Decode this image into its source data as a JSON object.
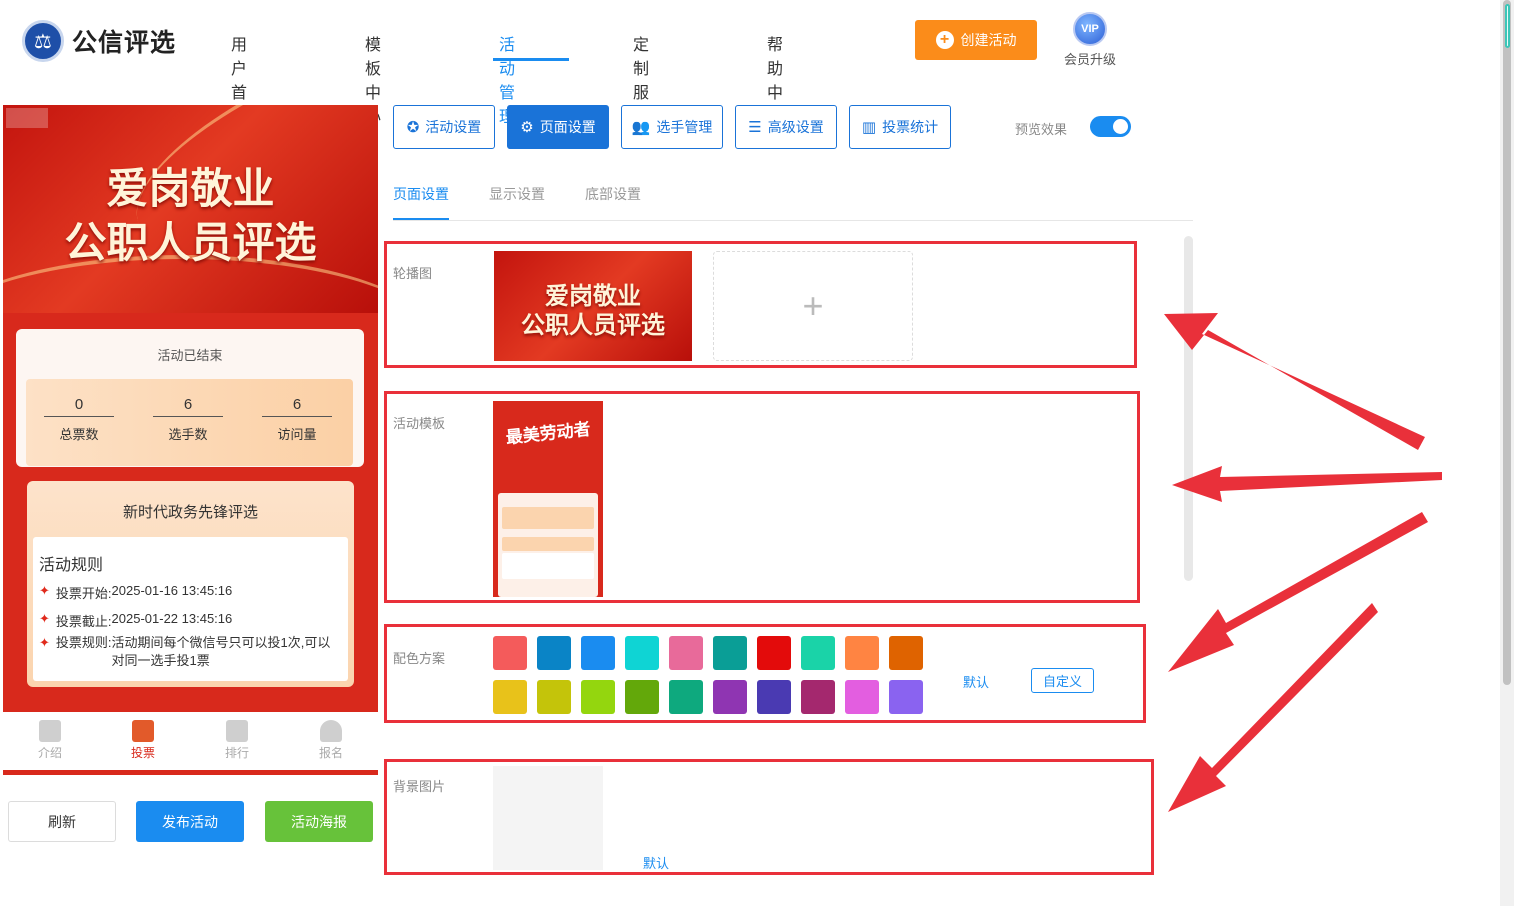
{
  "header": {
    "logo_text": "公信评选",
    "nav": [
      "用户首页",
      "模板中心",
      "活动管理",
      "定制服务",
      "帮助中心"
    ],
    "active_nav": "活动管理",
    "create_label": "创建活动",
    "vip_badge": "VIP",
    "vip_label": "会员升级"
  },
  "preview": {
    "banner_line1": "爱岗敬业",
    "banner_line2": "公职人员评选",
    "status": "活动已结束",
    "stats": [
      {
        "value": "0",
        "label": "总票数"
      },
      {
        "value": "6",
        "label": "选手数"
      },
      {
        "value": "6",
        "label": "访问量"
      }
    ],
    "event_title": "新时代政务先锋评选",
    "rules_heading": "活动规则",
    "rules": [
      {
        "key": "投票开始:",
        "value": "2025-01-16 13:45:16"
      },
      {
        "key": "投票截止:",
        "value": "2025-01-22 13:45:16"
      },
      {
        "key": "投票规则:",
        "value": "活动期间每个微信号只可以投1次,可以对同一选手投1票"
      }
    ],
    "tabs": [
      "介绍",
      "投票",
      "排行",
      "报名"
    ],
    "active_tab": "投票"
  },
  "actions": {
    "refresh": "刷新",
    "publish": "发布活动",
    "poster": "活动海报"
  },
  "toolbar": {
    "buttons": [
      "活动设置",
      "页面设置",
      "选手管理",
      "高级设置",
      "投票统计"
    ],
    "active": "页面设置",
    "preview_label": "预览效果",
    "preview_on": true
  },
  "subtabs": {
    "items": [
      "页面设置",
      "显示设置",
      "底部设置"
    ],
    "active": "页面设置"
  },
  "form": {
    "carousel_label": "轮播图",
    "carousel_thumb_line1": "爱岗敬业",
    "carousel_thumb_line2": "公职人员评选",
    "upload_plus": "+",
    "template_label": "活动模板",
    "template_title": "最美劳动者",
    "color_label": "配色方案",
    "colors_row1": [
      "#f45b5b",
      "#0a84c6",
      "#1a8cf0",
      "#0fd4d4",
      "#e86a9a",
      "#0a9e96",
      "#e30b0b",
      "#1ad3a8",
      "#ff8442",
      "#df6300"
    ],
    "colors_row2": [
      "#e8c21a",
      "#c4c40a",
      "#94d60e",
      "#63a80a",
      "#0ea97e",
      "#8f35b2",
      "#4a3ab2",
      "#a4286e",
      "#e35ee0",
      "#8a63f0"
    ],
    "color_default": "默认",
    "color_custom": "自定义",
    "bg_label": "背景图片",
    "bg_default": "默认"
  },
  "colors": {
    "primary": "#1a8cf0",
    "orange": "#fb8c1a",
    "highlight_red": "#e9303a",
    "publish_blue": "#1a8cf0",
    "poster_green": "#67c23a"
  }
}
